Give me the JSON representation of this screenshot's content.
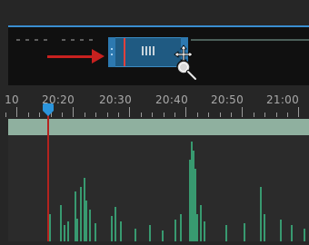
{
  "timeline": {
    "ruler_labels": [
      "10",
      "20:20",
      "20:30",
      "20:40",
      "20:50",
      "21:00"
    ]
  },
  "zoom_bar": {
    "grip_icon": "grip-lines-icon",
    "cursor_icon": "move-cursor-icon",
    "zoom_icon": "magnifier-icon"
  },
  "annotation": {
    "arrow_icon": "red-arrow-icon"
  },
  "colors": {
    "playhead": "#2b95dc",
    "zoom_selection": "#1f5a82",
    "arrow": "#c8211f",
    "waveform": "#3ec98e",
    "audio_clip_band": "#8fb09f"
  }
}
